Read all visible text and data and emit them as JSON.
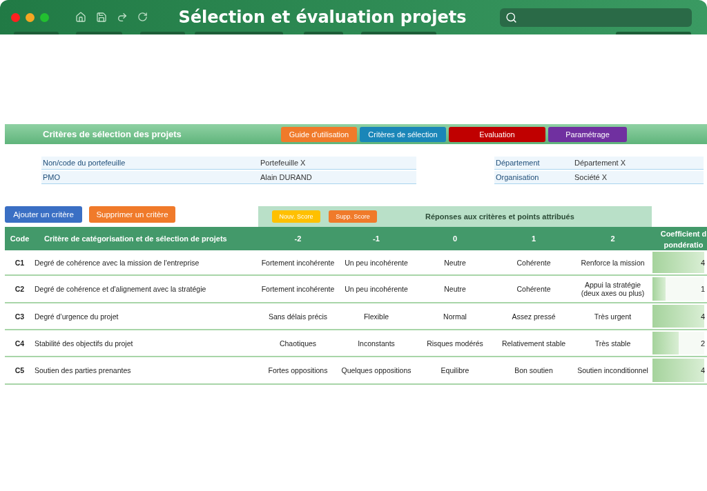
{
  "window": {
    "title": "Sélection et évaluation projets"
  },
  "banner": {
    "title": "Critères de sélection des projets",
    "buttons": [
      {
        "label": "Guide d'utilisation",
        "color": "#f07a2a"
      },
      {
        "label": "Critères de sélection",
        "color": "#1a86b8"
      },
      {
        "label": "Evaluation",
        "color": "#c00000"
      },
      {
        "label": "Paramétrage",
        "color": "#7030a0"
      }
    ]
  },
  "info_left": [
    {
      "label": "Non/code du portefeuille",
      "value": "Portefeuille X"
    },
    {
      "label": "PMO",
      "value": "Alain DURAND"
    }
  ],
  "info_right": [
    {
      "label": "Département",
      "value": "Département X"
    },
    {
      "label": "Organisation",
      "value": "Société X"
    }
  ],
  "actions": [
    {
      "label": "Ajouter un critère",
      "color": "#3a6fc4"
    },
    {
      "label": "Supprimer un critère",
      "color": "#f07a2a"
    }
  ],
  "score_band": {
    "title": "Réponses aux critères et points attribués",
    "buttons": [
      {
        "label": "Nouv. Score",
        "color": "#ffc000"
      },
      {
        "label": "Supp. Score",
        "color": "#f07a2a"
      }
    ]
  },
  "table": {
    "columns": [
      "Code",
      "Critère de catégorisation et de sélection de projets",
      "-2",
      "-1",
      "0",
      "1",
      "2"
    ],
    "weight_header": [
      "Coefficient d",
      "pondératio"
    ],
    "rows": [
      {
        "code": "C1",
        "criterion": "Degré de cohérence avec la mission de l'entreprise",
        "answers": [
          "Fortement incohérente",
          "Un peu incohérente",
          "Neutre",
          "Cohérente",
          "Renforce la mission"
        ],
        "weight": "4",
        "level": 1
      },
      {
        "code": "C2",
        "criterion": "Degré de cohérence et d'alignement avec la stratégie",
        "answers": [
          "Fortement incohérente",
          "Un peu incohérente",
          "Neutre",
          "Cohérente",
          "Appui la stratégie (deux axes ou plus)"
        ],
        "weight": "1",
        "level": 0.25
      },
      {
        "code": "C3",
        "criterion": "Degré d’urgence du projet",
        "answers": [
          "Sans délais précis",
          "Flexible",
          "Normal",
          "Assez pressé",
          "Très urgent"
        ],
        "weight": "4",
        "level": 1
      },
      {
        "code": "C4",
        "criterion": "Stabilité des objectifs du projet",
        "answers": [
          "Chaotiques",
          "Inconstants",
          "Risques modérés",
          "Relativement stable",
          "Très stable"
        ],
        "weight": "2",
        "level": 0.5
      },
      {
        "code": "C5",
        "criterion": "Soutien des parties prenantes",
        "answers": [
          "Fortes oppositions",
          "Quelques oppositions",
          "Equilibre",
          "Bon soutien",
          "Soutien inconditionnel"
        ],
        "weight": "4",
        "level": 1
      }
    ]
  }
}
